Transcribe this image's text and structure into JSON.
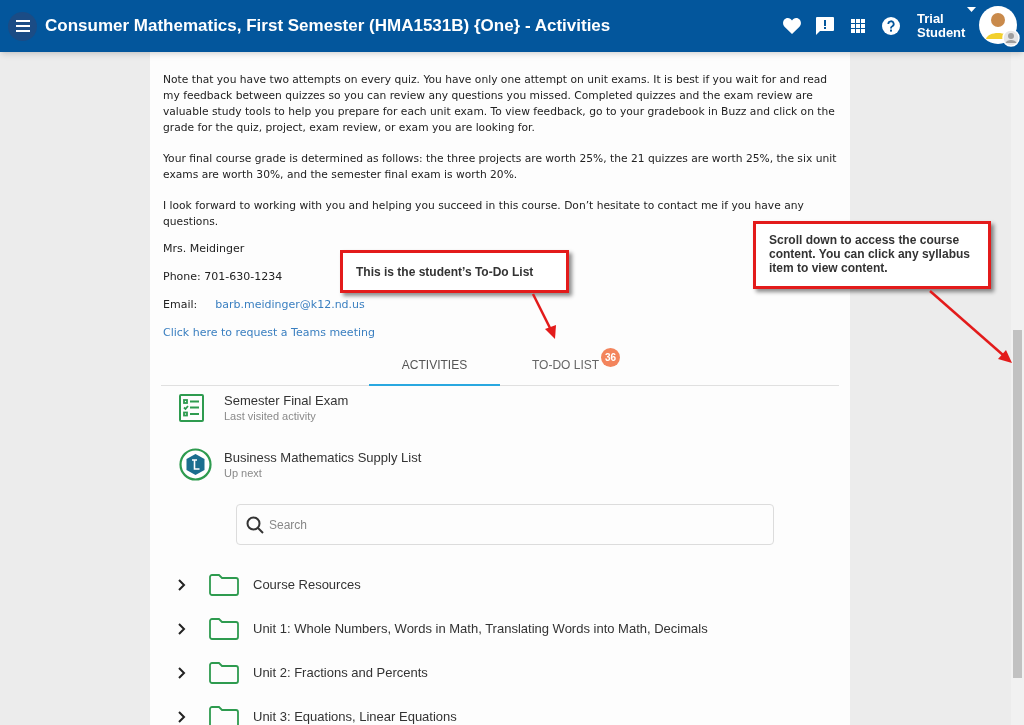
{
  "header": {
    "title": "Consumer Mathematics, First Semester (HMA1531B) {One} - Activities",
    "user": "Trial Student"
  },
  "intro": {
    "paragraphs": [
      "Note that you have two attempts on every quiz. You have only one attempt on unit exams. It is best if you wait for and read my feedback between quizzes so you can review any questions you missed. Completed quizzes and the exam review are valuable study tools to help you prepare for each unit exam. To view feedback, go to your gradebook in Buzz and click on the grade for the quiz, project, exam review, or exam you are looking for.",
      "Your final course grade is determined as follows: the three projects are worth 25%, the 21 quizzes are worth 25%, the six unit exams are worth 30%, and the semester final exam is worth 20%.",
      "I look forward to working with you and helping you succeed in this course. Don’t hesitate to contact me if you have any questions."
    ],
    "signature": "Mrs. Meidinger",
    "phone": "Phone: 701-630-1234",
    "email_label": "Email:",
    "email": "barb.meidinger@k12.nd.us",
    "teams_link": "Click here to request a Teams meeting"
  },
  "tabs": [
    {
      "label": "ACTIVITIES",
      "selected": true
    },
    {
      "label": "TO-DO LIST",
      "selected": false,
      "badge": "36"
    }
  ],
  "recent": [
    {
      "kind": "quiz",
      "title": "Semester Final Exam",
      "subtitle": "Last visited activity"
    },
    {
      "kind": "resource",
      "title": "Business Mathematics Supply List",
      "subtitle": "Up next"
    }
  ],
  "search": {
    "placeholder": "Search"
  },
  "folders": [
    {
      "label": "Course Resources",
      "expanded": false
    },
    {
      "label": "Unit 1: Whole Numbers, Words in Math, Translating Words into Math, Decimals",
      "expanded": false
    },
    {
      "label": "Unit 2: Fractions and Percents",
      "expanded": false
    },
    {
      "label": "Unit 3: Equations, Linear Equations",
      "expanded": false
    }
  ],
  "callouts": [
    {
      "text": "This is the student’s To-Do List"
    },
    {
      "text": "Scroll down to access the course content. You can click any syllabus item to view content."
    }
  ]
}
